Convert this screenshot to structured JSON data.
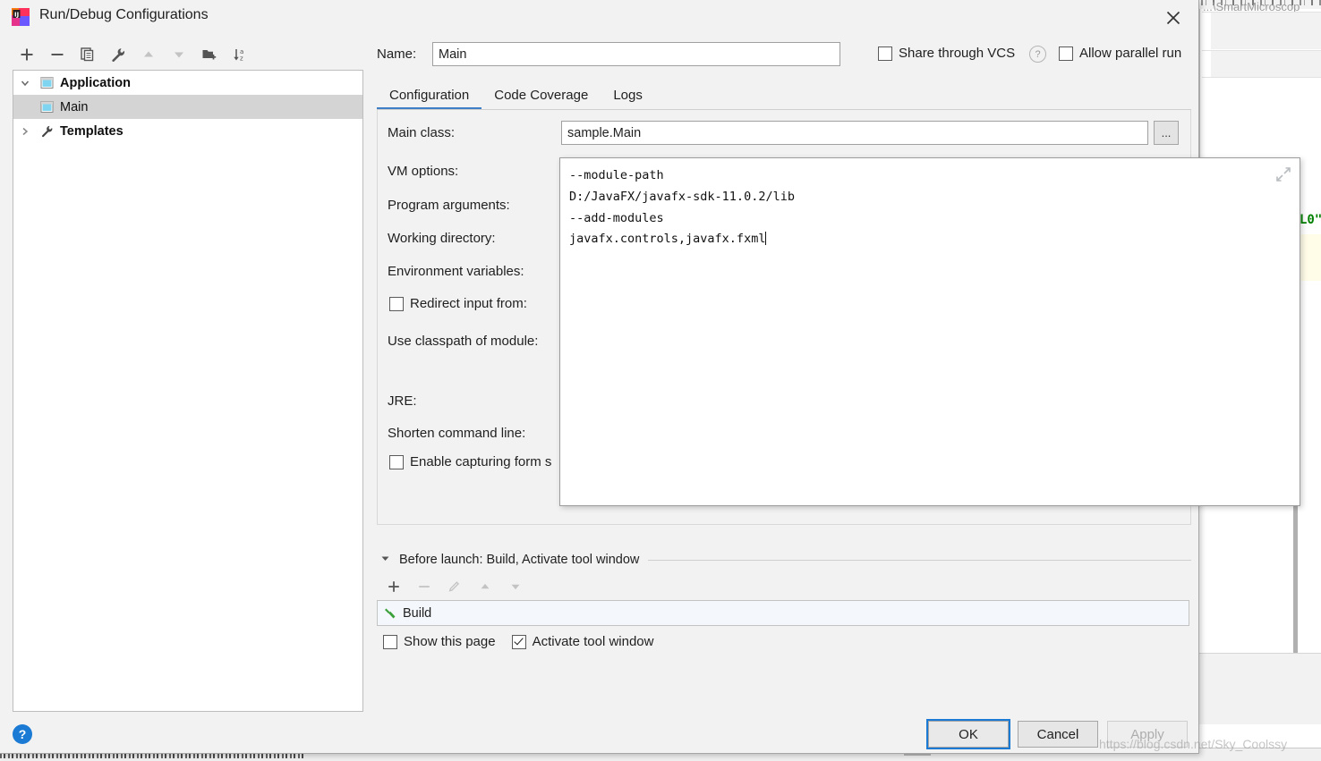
{
  "window": {
    "title": "Run/Debug Configurations",
    "logo_icon": "intellij-idea-logo",
    "close_icon": "close-icon"
  },
  "left_toolbar": {
    "buttons": [
      {
        "name": "add-configuration-button",
        "icon": "plus-icon",
        "enabled": true
      },
      {
        "name": "remove-configuration-button",
        "icon": "minus-icon",
        "enabled": true
      },
      {
        "name": "copy-configuration-button",
        "icon": "copy-icon",
        "enabled": true
      },
      {
        "name": "edit-templates-button",
        "icon": "wrench-icon",
        "enabled": true
      },
      {
        "name": "move-up-button",
        "icon": "arrow-up-icon",
        "enabled": false
      },
      {
        "name": "move-down-button",
        "icon": "arrow-down-icon",
        "enabled": false
      },
      {
        "name": "create-folder-button",
        "icon": "folder-add-icon",
        "enabled": true
      },
      {
        "name": "sort-configurations-button",
        "icon": "sort-az-icon",
        "enabled": true
      }
    ]
  },
  "tree": {
    "items": [
      {
        "label": "Application",
        "icon": "application-icon",
        "arrow": "chevron-down-icon",
        "bold": true,
        "level": 0,
        "selected": false
      },
      {
        "label": "Main",
        "icon": "application-icon",
        "arrow": "",
        "bold": false,
        "level": 1,
        "selected": true
      },
      {
        "label": "Templates",
        "icon": "wrench-icon",
        "arrow": "chevron-right-icon",
        "bold": true,
        "level": 0,
        "selected": false
      }
    ]
  },
  "header": {
    "name_label": "Name:",
    "name_value": "Main",
    "name_placeholder": "",
    "share_vcs_label": "Share through VCS",
    "share_vcs_checked": false,
    "help_icon": "question-mark-icon",
    "allow_parallel_label": "Allow parallel run",
    "allow_parallel_checked": false
  },
  "tabs": [
    {
      "label": "Configuration",
      "active": true
    },
    {
      "label": "Code Coverage",
      "active": false
    },
    {
      "label": "Logs",
      "active": false
    }
  ],
  "config": {
    "main_class_label": "Main class:",
    "main_class_value": "sample.Main",
    "main_class_browse": "...",
    "vm_options_label": "VM options:",
    "program_arguments_label": "Program arguments:",
    "working_directory_label": "Working directory:",
    "environment_variables_label": "Environment variables:",
    "redirect_input_label": "Redirect input from:",
    "redirect_input_checked": false,
    "use_classpath_label": "Use classpath of module:",
    "jre_label": "JRE:",
    "shorten_command_line_label": "Shorten command line:",
    "enable_capturing_label": "Enable capturing form s",
    "enable_capturing_checked": false
  },
  "vm_popup": {
    "collapse_icon": "collapse-icon",
    "lines": [
      "--module-path",
      "D:/JavaFX/javafx-sdk-11.0.2/lib",
      "--add-modules",
      "javafx.controls,javafx.fxml"
    ]
  },
  "before_launch": {
    "caret_icon": "triangle-down-icon",
    "title": "Before launch: Build, Activate tool window",
    "toolbar": [
      {
        "name": "add-task-button",
        "icon": "plus-icon",
        "enabled": true
      },
      {
        "name": "remove-task-button",
        "icon": "minus-icon",
        "enabled": false
      },
      {
        "name": "edit-task-button",
        "icon": "pencil-icon",
        "enabled": false
      },
      {
        "name": "task-move-up-button",
        "icon": "arrow-up-icon",
        "enabled": false
      },
      {
        "name": "task-move-down-button",
        "icon": "arrow-down-icon",
        "enabled": false
      }
    ],
    "items": [
      {
        "label": "Build",
        "icon": "hammer-icon"
      }
    ],
    "show_this_page_label": "Show this page",
    "show_this_page_checked": false,
    "activate_tool_window_label": "Activate tool window",
    "activate_tool_window_checked": true
  },
  "footer": {
    "help_icon_label": "?",
    "ok_label": "OK",
    "ok_is_default": true,
    "cancel_label": "Cancel",
    "apply_label": "Apply",
    "apply_enabled": false
  },
  "background": {
    "breadcrumb": "...\\SmartMicroscop",
    "code_token": "L0\"",
    "watermark": "https://blog.csdn.net/Sky_Coolssy"
  },
  "colors": {
    "accent": "#1a7ad4",
    "tab_indicator": "#3d7ec4",
    "dialog_bg": "#f2f2f2",
    "selection": "#d4d4d4",
    "hammer_green": "#3aa03a",
    "code_green": "#008000"
  }
}
